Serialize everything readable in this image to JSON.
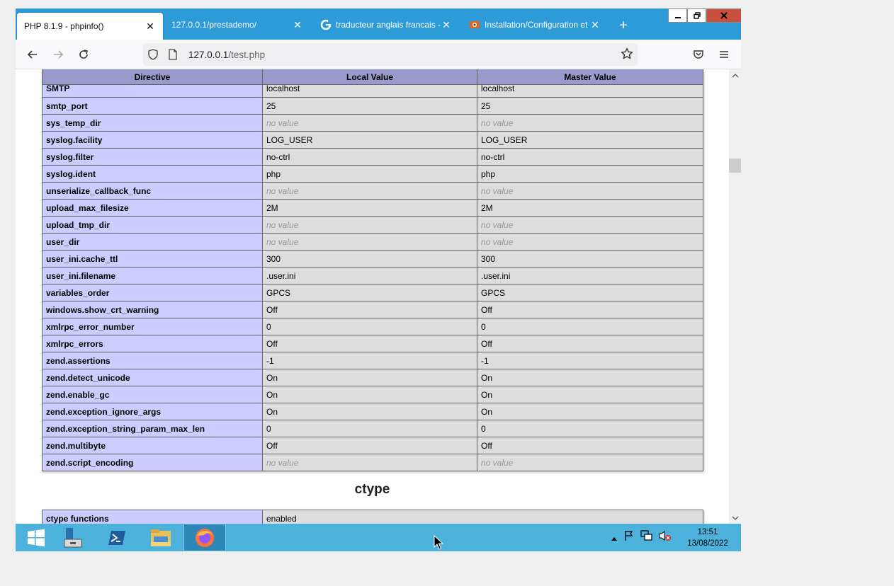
{
  "tabs": [
    {
      "title": "PHP 8.1.9 - phpinfo()",
      "active": true,
      "icon": "none"
    },
    {
      "title": "127.0.0.1/prestademo/",
      "active": false,
      "icon": "none"
    },
    {
      "title": "traducteur anglais francais - G",
      "active": false,
      "icon": "google-icon"
    },
    {
      "title": "Installation/Configuration et",
      "active": false,
      "icon": "favicon-icon"
    }
  ],
  "toolbar": {
    "url_host": "127.0.0.1",
    "url_path": "/test.php"
  },
  "table": {
    "headers": [
      "Directive",
      "Local Value",
      "Master Value"
    ],
    "partial_row": {
      "directive": "SMTP",
      "local": "localhost",
      "master": "localhost"
    },
    "rows": [
      {
        "directive": "smtp_port",
        "local": "25",
        "master": "25"
      },
      {
        "directive": "sys_temp_dir",
        "local": "no value",
        "master": "no value"
      },
      {
        "directive": "syslog.facility",
        "local": "LOG_USER",
        "master": "LOG_USER"
      },
      {
        "directive": "syslog.filter",
        "local": "no-ctrl",
        "master": "no-ctrl"
      },
      {
        "directive": "syslog.ident",
        "local": "php",
        "master": "php"
      },
      {
        "directive": "unserialize_callback_func",
        "local": "no value",
        "master": "no value"
      },
      {
        "directive": "upload_max_filesize",
        "local": "2M",
        "master": "2M"
      },
      {
        "directive": "upload_tmp_dir",
        "local": "no value",
        "master": "no value"
      },
      {
        "directive": "user_dir",
        "local": "no value",
        "master": "no value"
      },
      {
        "directive": "user_ini.cache_ttl",
        "local": "300",
        "master": "300"
      },
      {
        "directive": "user_ini.filename",
        "local": ".user.ini",
        "master": ".user.ini"
      },
      {
        "directive": "variables_order",
        "local": "GPCS",
        "master": "GPCS"
      },
      {
        "directive": "windows.show_crt_warning",
        "local": "Off",
        "master": "Off"
      },
      {
        "directive": "xmlrpc_error_number",
        "local": "0",
        "master": "0"
      },
      {
        "directive": "xmlrpc_errors",
        "local": "Off",
        "master": "Off"
      },
      {
        "directive": "zend.assertions",
        "local": "-1",
        "master": "-1"
      },
      {
        "directive": "zend.detect_unicode",
        "local": "On",
        "master": "On"
      },
      {
        "directive": "zend.enable_gc",
        "local": "On",
        "master": "On"
      },
      {
        "directive": "zend.exception_ignore_args",
        "local": "On",
        "master": "On"
      },
      {
        "directive": "zend.exception_string_param_max_len",
        "local": "0",
        "master": "0"
      },
      {
        "directive": "zend.multibyte",
        "local": "Off",
        "master": "Off"
      },
      {
        "directive": "zend.script_encoding",
        "local": "no value",
        "master": "no value"
      }
    ]
  },
  "ctype": {
    "heading": "ctype",
    "row": {
      "label": "ctype functions",
      "value": "enabled"
    }
  },
  "taskbar": {
    "time": "13:51",
    "date": "13/08/2022"
  },
  "colors": {
    "tabstrip": "#2d9bd8",
    "header_cell": "#9999cc",
    "key_cell": "#ccccff",
    "value_cell": "#dddddd",
    "taskbar": "#4cb2dc"
  }
}
